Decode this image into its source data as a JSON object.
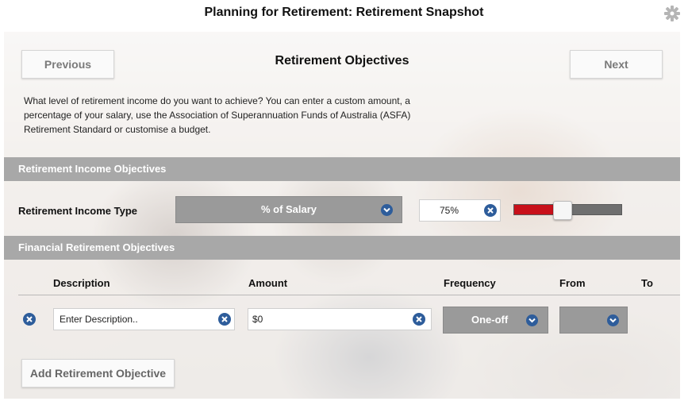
{
  "app": {
    "title": "Planning for Retirement: Retirement Snapshot",
    "settings_icon": "gear-icon"
  },
  "nav": {
    "previous_label": "Previous",
    "next_label": "Next",
    "section_title": "Retirement Objectives"
  },
  "intro_text": "What level of retirement income do you want to achieve? You can enter a custom amount, a percentage of your salary, use the Association of Superannuation Funds of Australia (ASFA) Retirement Standard or customise a budget.",
  "income_objectives": {
    "header": "Retirement Income Objectives",
    "type_label": "Retirement Income Type",
    "type_selected": "% of Salary",
    "percent_value": "75%",
    "slider_level": 0.36,
    "slider_color": "#c8101a"
  },
  "financial_objectives": {
    "header": "Financial Retirement Objectives",
    "columns": [
      "Description",
      "Amount",
      "Frequency",
      "From",
      "To"
    ],
    "row": {
      "description_placeholder": "Enter Description..",
      "amount_value": "$0",
      "frequency_selected": "One-off",
      "from_selected": ""
    },
    "add_label": "Add Retirement Objective"
  },
  "colors": {
    "accent_blue": "#2e5d9b",
    "section_bar": "#a8a8a8",
    "select_bg": "#9a9a9a"
  }
}
